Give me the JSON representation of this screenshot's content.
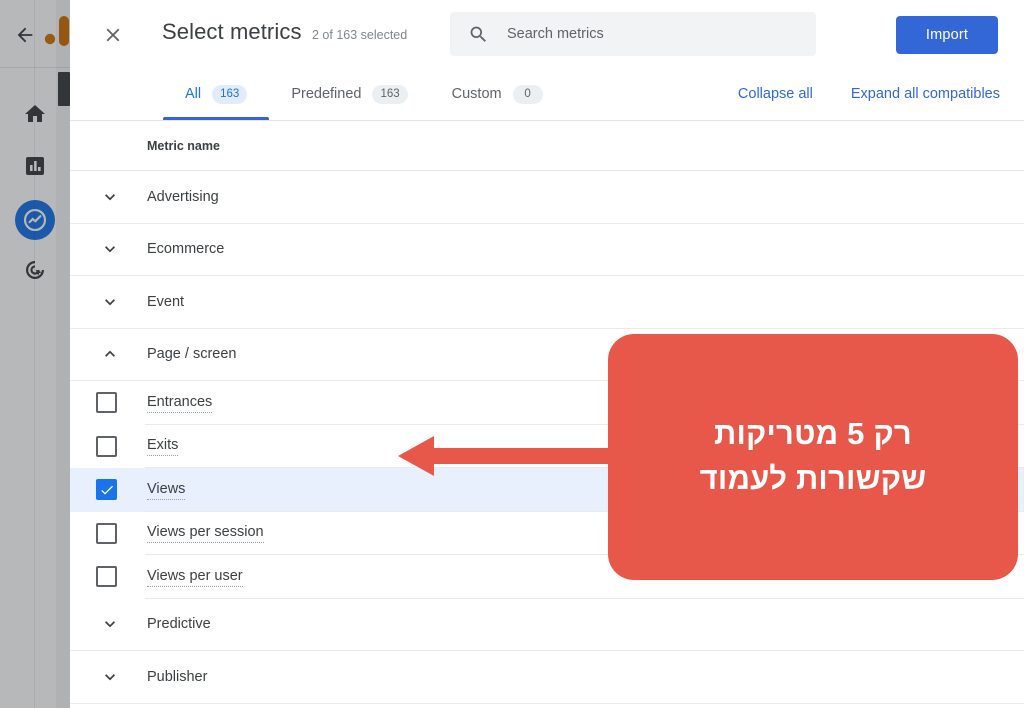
{
  "rail": {
    "back_icon": "back-arrow-icon",
    "logo": "google-analytics-logo",
    "items": [
      {
        "name": "home",
        "icon": "home-icon",
        "active": false
      },
      {
        "name": "reports",
        "icon": "bar-chart-icon",
        "active": false
      },
      {
        "name": "explore",
        "icon": "explore-compass-icon",
        "active": true
      },
      {
        "name": "advertising",
        "icon": "advertising-target-icon",
        "active": false
      }
    ]
  },
  "dialog": {
    "close_icon": "close-icon",
    "title": "Select metrics",
    "subtitle": "2 of 163 selected",
    "search": {
      "icon": "search-icon",
      "placeholder": "Search metrics",
      "value": ""
    },
    "import_label": "Import"
  },
  "tabs": [
    {
      "label": "All",
      "count": "163",
      "active": true
    },
    {
      "label": "Predefined",
      "count": "163",
      "active": false
    },
    {
      "label": "Custom",
      "count": "0",
      "active": false
    }
  ],
  "tab_actions": {
    "collapse_all": "Collapse all",
    "expand_all": "Expand all compatibles"
  },
  "table": {
    "column_header": "Metric name",
    "rows": [
      {
        "kind": "group",
        "label": "Advertising",
        "expanded": false,
        "icon": "chevron-down-icon"
      },
      {
        "kind": "group",
        "label": "Ecommerce",
        "expanded": false,
        "icon": "chevron-down-icon"
      },
      {
        "kind": "group",
        "label": "Event",
        "expanded": false,
        "icon": "chevron-down-icon"
      },
      {
        "kind": "group",
        "label": "Page / screen",
        "expanded": true,
        "icon": "chevron-up-icon"
      },
      {
        "kind": "item",
        "label": "Entrances",
        "checked": false
      },
      {
        "kind": "item",
        "label": "Exits",
        "checked": false
      },
      {
        "kind": "item",
        "label": "Views",
        "checked": true
      },
      {
        "kind": "item",
        "label": "Views per session",
        "checked": false
      },
      {
        "kind": "item",
        "label": "Views per user",
        "checked": false
      },
      {
        "kind": "group",
        "label": "Predictive",
        "expanded": false,
        "icon": "chevron-down-icon"
      },
      {
        "kind": "group",
        "label": "Publisher",
        "expanded": false,
        "icon": "chevron-down-icon"
      }
    ]
  },
  "annotation": {
    "callout_line1": "רק 5 מטריקות",
    "callout_line2": "שקשורות לעמוד",
    "arrow_icon": "left-arrow-annotation",
    "color": "#e8584a"
  },
  "colors": {
    "accent_blue": "#1a73e8",
    "button_blue": "#3367d6",
    "selected_row": "#e8f0fe",
    "annotation_red": "#e8584a",
    "logo_orange": "#d3750b"
  }
}
